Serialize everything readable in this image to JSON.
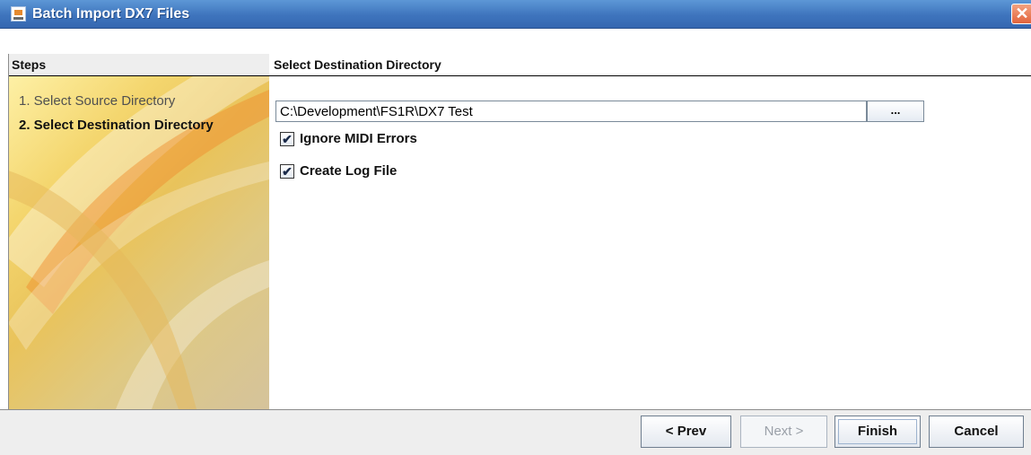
{
  "window": {
    "title": "Batch Import DX7 Files",
    "close_glyph": "✕"
  },
  "steps": {
    "header": "Steps",
    "items": [
      {
        "label": "1. Select Source Directory"
      },
      {
        "label": "2. Select Destination Directory"
      }
    ]
  },
  "destination": {
    "header": "Select Destination Directory",
    "path_value": "C:\\Development\\FS1R\\DX7 Test",
    "browse_label": "..."
  },
  "options": {
    "ignore_midi_errors": {
      "label": "Ignore MIDI Errors",
      "checked": true,
      "mark": "✔"
    },
    "create_log_file": {
      "label": "Create Log File",
      "checked": true,
      "mark": "✔"
    }
  },
  "buttons": {
    "prev": "< Prev",
    "next": "Next >",
    "finish": "Finish",
    "cancel": "Cancel"
  }
}
